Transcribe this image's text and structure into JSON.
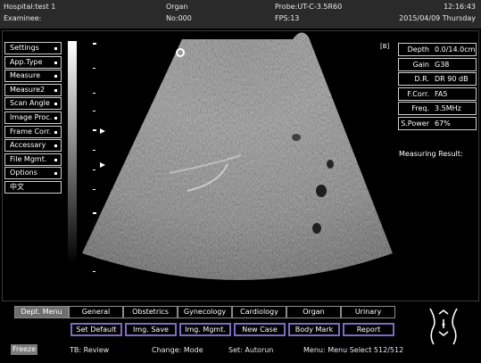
{
  "header": {
    "hospital": "Hospital:test 1",
    "examinee": "Examinee:",
    "organ": "Organ",
    "no": "No:000",
    "probe": "Probe:UT-C-3.5R60",
    "fps": "FPS:13",
    "time": "12:16:43",
    "date": "2015/04/09 Thursday"
  },
  "side_menu": [
    "Settings",
    "App.Type",
    "Measure",
    "Measure2",
    "Scan Angle",
    "Image Proc.",
    "Frame Corr.",
    "Accessary",
    "File Mgmt.",
    "Options",
    "中文"
  ],
  "image_marker": "[B]",
  "params": [
    {
      "label": "Depth",
      "value": "0.0/14.0cm"
    },
    {
      "label": "Gain",
      "value": "G38"
    },
    {
      "label": "D.R.",
      "value": "DR 90 dB"
    },
    {
      "label": "F.Corr.",
      "value": "FA5"
    },
    {
      "label": "Freq.",
      "value": "3.5MHz"
    },
    {
      "label": "S.Power",
      "value": "67%"
    }
  ],
  "measuring_result": "Measuring Result:",
  "dept_tabs": [
    "Dept. Menu",
    "General",
    "Obstetrics",
    "Gynecology",
    "Cardiology",
    "Organ",
    "Urinary"
  ],
  "dept_active_index": 0,
  "actions": [
    "Set Default",
    "Img. Save",
    "Img. Mgmt.",
    "New Case",
    "Body Mark",
    "Report"
  ],
  "footer": {
    "freeze": "Freeze",
    "tb": "TB: Review",
    "change": "Change: Mode",
    "set": "Set: Autorun",
    "menu": "Menu: Menu Select  512/512"
  },
  "colors": {
    "header_bg": "#2a2a2a",
    "action_border": "#7c6bc2",
    "active_tab": "#6e6e6e"
  }
}
